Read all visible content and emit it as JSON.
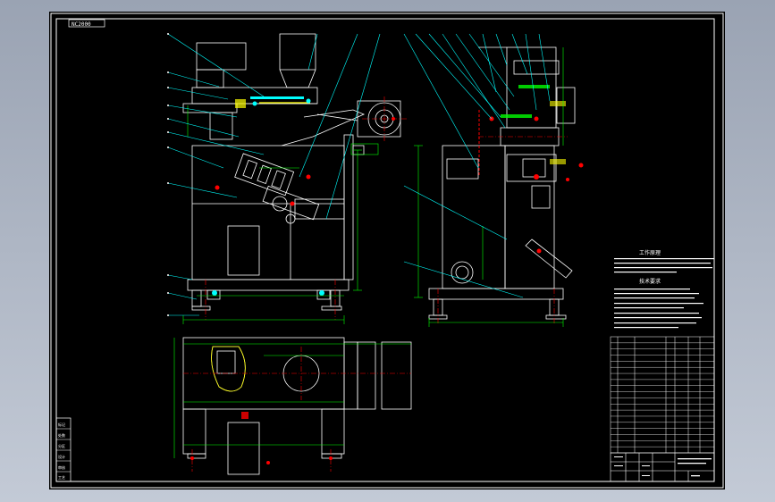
{
  "drawing": {
    "title_tag": "NC2000",
    "notes_title_1": "工作原理",
    "notes_title_2": "技术要求",
    "left_strip": [
      "标记",
      "处数",
      "分区",
      "设计",
      "审核",
      "工艺"
    ]
  },
  "colors": {
    "background": "#000000",
    "frame": "#ffffff",
    "outline": "#ffffff",
    "dimension": "#00ff00",
    "leader": "#00ffff",
    "center_line": "#ff0000",
    "hatch": "#ffff00",
    "viewport": "#adb5c3"
  }
}
